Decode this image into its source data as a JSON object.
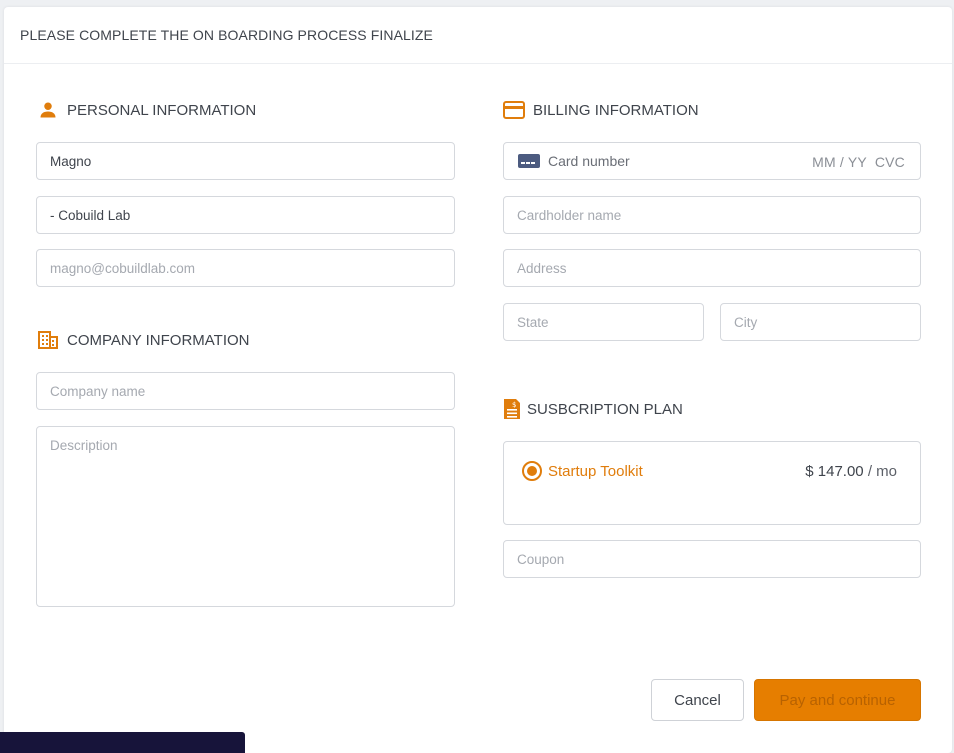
{
  "header": {
    "title": "PLEASE COMPLETE THE ON BOARDING PROCESS FINALIZE"
  },
  "personal": {
    "title": "PERSONAL INFORMATION",
    "icon": "person-icon",
    "name_value": "Magno",
    "company_value": "- Cobuild Lab",
    "email_placeholder": "magno@cobuildlab.com"
  },
  "company": {
    "title": "COMPANY INFORMATION",
    "icon": "building-icon",
    "name_placeholder": "Company name",
    "description_placeholder": "Description"
  },
  "billing": {
    "title": "BILLING INFORMATION",
    "icon": "credit-card-icon",
    "card_number_placeholder": "Card number",
    "card_expiry_cvc_placeholder": "MM / YY  CVC",
    "cardholder_placeholder": "Cardholder name",
    "address_placeholder": "Address",
    "state_placeholder": "State",
    "city_placeholder": "City"
  },
  "subscription": {
    "title": "SUSBCRIPTION PLAN",
    "icon": "invoice-icon",
    "plan_name": "Startup Toolkit",
    "plan_price": "$ 147.00",
    "plan_period": "/ mo",
    "coupon_placeholder": "Coupon"
  },
  "actions": {
    "cancel_label": "Cancel",
    "pay_label": "Pay and continue"
  },
  "colors": {
    "accent": "#e07d0c",
    "pay_button": "#e67e00",
    "border": "#d5d8dd",
    "footer_bar": "#17143a"
  }
}
